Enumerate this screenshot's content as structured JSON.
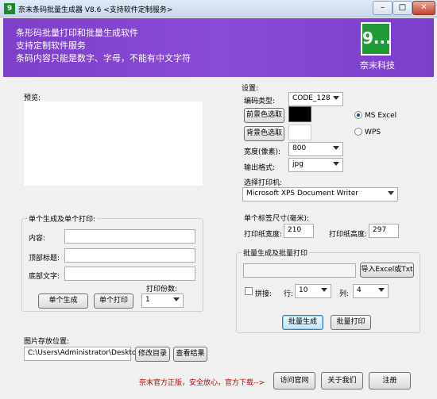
{
  "window": {
    "title": "奈末条码批量生成器 V8.6 <支持软件定制服务>",
    "icon_label": "9",
    "controls": {
      "minimize": "–",
      "maximize": "□",
      "close": "✕"
    }
  },
  "banner": {
    "lines": [
      "条形码批量打印和批量生成软件",
      "支持定制软件服务",
      "条码内容只能是数字、字母，不能有中文字符"
    ],
    "logo_glyph": "9...",
    "logo_caption": "奈末科技"
  },
  "preview": {
    "label": "预览:"
  },
  "single": {
    "group_label": "单个生成及单个打印:",
    "content_label": "内容:",
    "content_value": "",
    "top_title_label": "顶部标题:",
    "top_title_value": "",
    "bottom_text_label": "底部文字:",
    "bottom_text_value": "",
    "copies_label": "打印份数:",
    "copies_value": "1",
    "generate_button": "单个生成",
    "print_button": "单个打印"
  },
  "save": {
    "label": "图片存放位置:",
    "path": "C:\\Users\\Administrator\\Desktop",
    "modify_button": "修改目录",
    "view_button": "查看结果"
  },
  "settings": {
    "group_label": "设置:",
    "barcode_type_label": "编码类型:",
    "barcode_type_value": "CODE_128",
    "fg_button": "前景色选取",
    "bg_button": "背景色选取",
    "fg_color": "#000000",
    "bg_color": "#ffffff",
    "ms_excel_label": "MS  Excel",
    "wps_label": "WPS",
    "ms_excel_selected": true,
    "width_label": "宽度(像素):",
    "width_value": "800",
    "format_label": "输出格式:",
    "format_value": "jpg",
    "printer_label": "选择打印机:",
    "printer_value": "Microsoft XPS Document Writer",
    "label_size_label": "单个标签尺寸(毫米):",
    "paper_width_label": "打印纸宽度:",
    "paper_width_value": "210",
    "paper_height_label": "打印纸高度:",
    "paper_height_value": "297"
  },
  "batch": {
    "group_label": "批量生成及批量打印",
    "import_button": "导入Excel或Txt",
    "file_value": "",
    "tile_label": "拼接:",
    "rows_label": "行:",
    "rows_value": "10",
    "cols_label": "列:",
    "cols_value": "4",
    "generate_button": "批量生成",
    "print_button": "批量打印"
  },
  "footer": {
    "notice": "奈末官方正版，安全放心，官方下载-->",
    "visit_button": "访问官网",
    "about_button": "关于我们",
    "register_button": "注册"
  }
}
